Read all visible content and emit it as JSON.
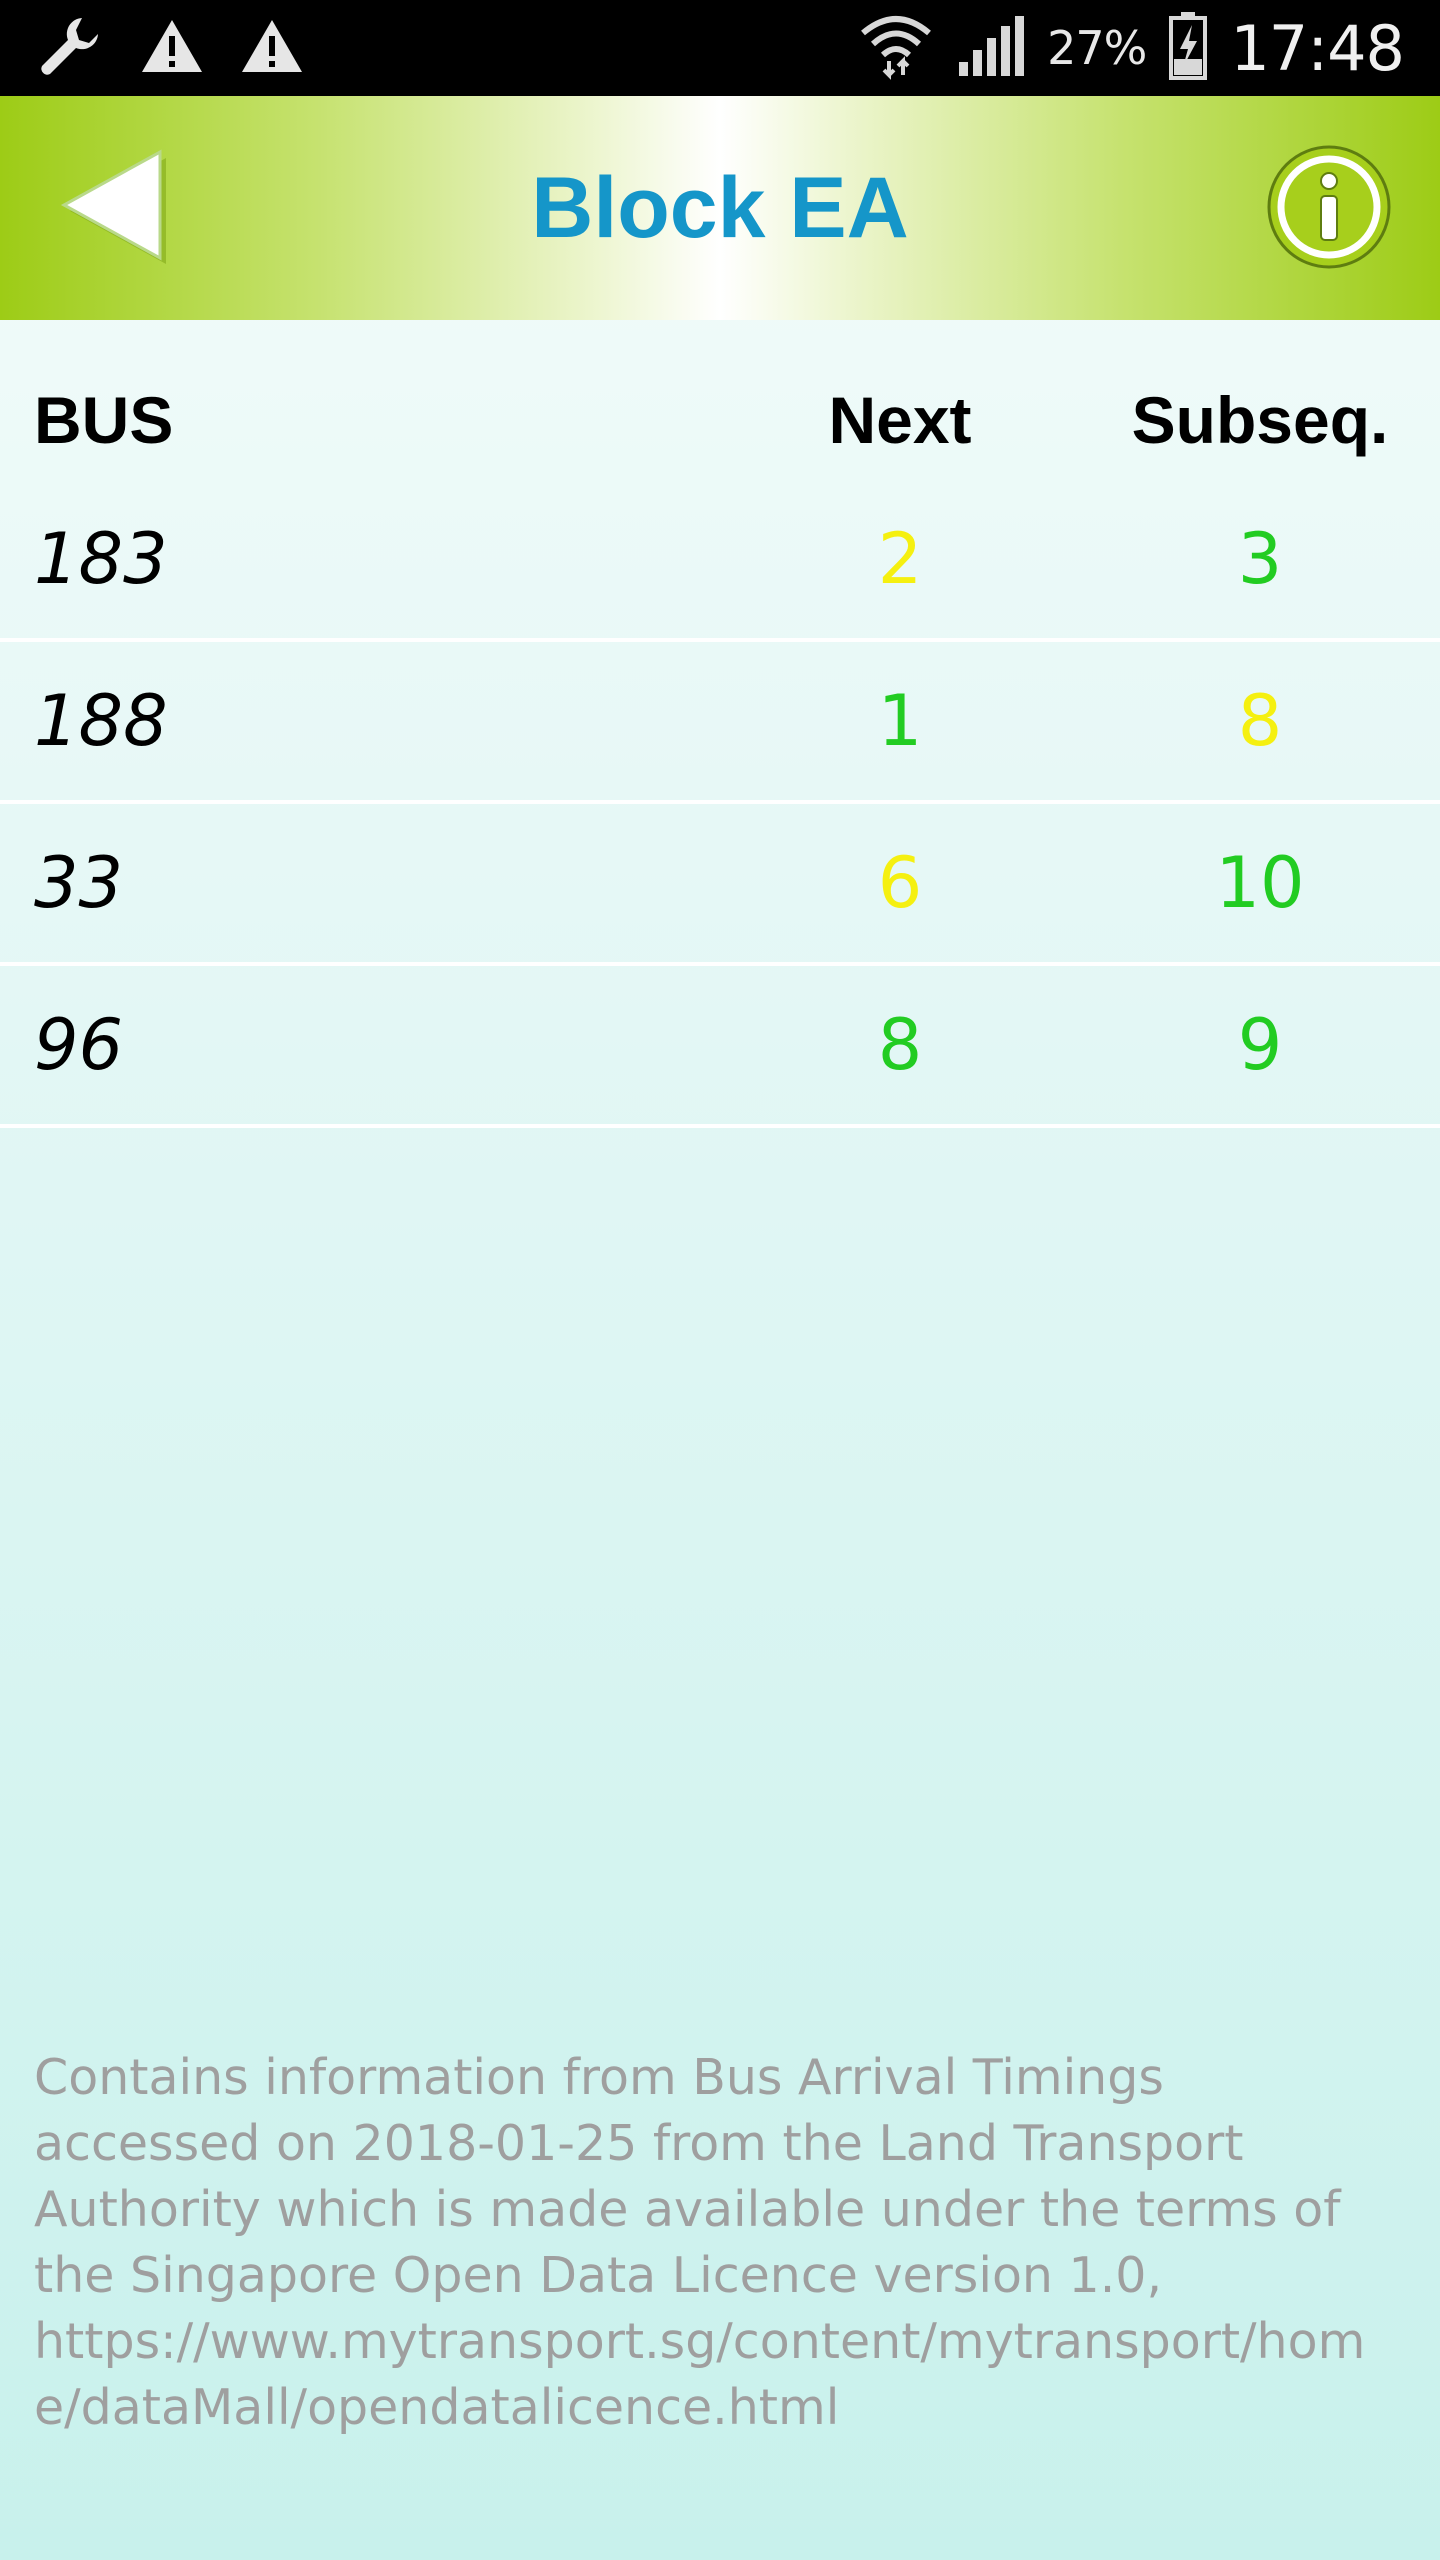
{
  "status_bar": {
    "battery_percent": "27%",
    "time": "17:48",
    "icons": [
      "wrench-icon",
      "warning-icon",
      "warning-icon",
      "wifi-icon",
      "signal-icon",
      "battery-icon"
    ]
  },
  "header": {
    "title": "Block EA",
    "back_icon": "back-arrow-icon",
    "info_icon": "info-icon",
    "colors": {
      "title": "#1596c9",
      "bar_edge": "#9dcc16",
      "bar_center": "#ffffff"
    }
  },
  "table": {
    "columns": {
      "bus": "BUS",
      "next": "Next",
      "subseq": "Subseq."
    },
    "rows": [
      {
        "bus": "183",
        "next": "2",
        "next_color": "#f5f010",
        "subseq": "3",
        "subseq_color": "#22cc22"
      },
      {
        "bus": "188",
        "next": "1",
        "next_color": "#22cc22",
        "subseq": "8",
        "subseq_color": "#f5f010"
      },
      {
        "bus": "33",
        "next": "6",
        "next_color": "#f5f010",
        "subseq": "10",
        "subseq_color": "#22cc22"
      },
      {
        "bus": "96",
        "next": "8",
        "next_color": "#22cc22",
        "subseq": "9",
        "subseq_color": "#22cc22"
      }
    ]
  },
  "footer": {
    "attribution": "Contains information from Bus Arrival Timings accessed on 2018-01-25 from the Land Transport Authority which is made available under the terms of the Singapore Open Data Licence version 1.0, https://www.mytransport.sg/content/mytransport/home/dataMall/opendatalicence.html"
  }
}
